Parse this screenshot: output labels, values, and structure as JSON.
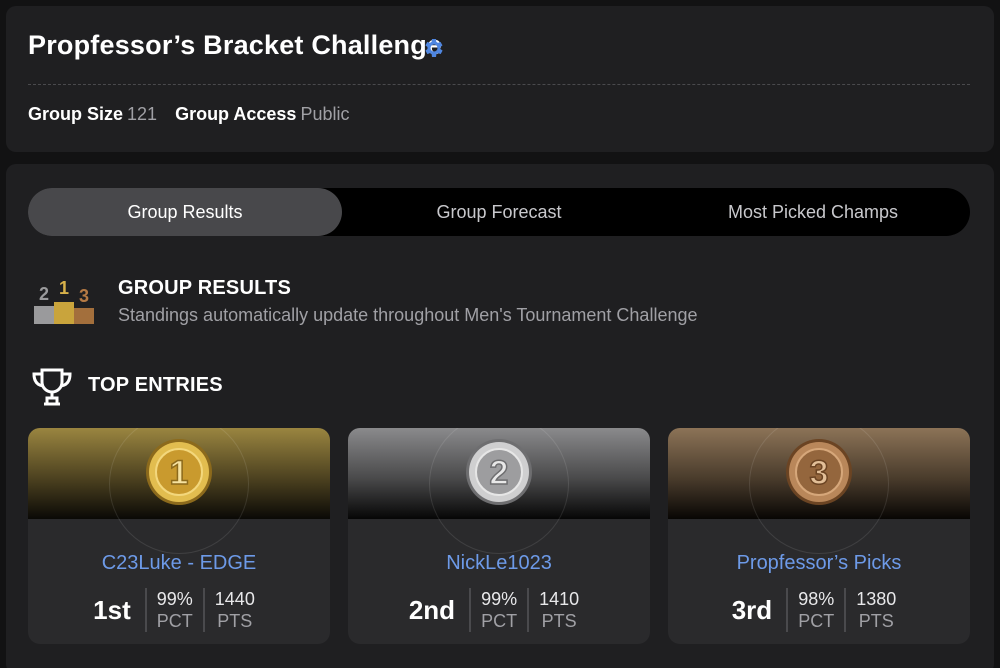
{
  "header": {
    "title": "Propfessor’s Bracket Challenge",
    "meta": [
      {
        "key": "Group Size",
        "value": "121"
      },
      {
        "key": "Group Access",
        "value": "Public"
      }
    ]
  },
  "tabs": [
    {
      "label": "Group Results",
      "active": true
    },
    {
      "label": "Group Forecast",
      "active": false
    },
    {
      "label": "Most Picked Champs",
      "active": false
    }
  ],
  "results_section": {
    "title": "GROUP RESULTS",
    "subtitle": "Standings automatically update throughout Men's Tournament Challenge",
    "podium_icon_digits": [
      "2",
      "1",
      "3"
    ]
  },
  "top_entries": {
    "title": "TOP ENTRIES",
    "cards": [
      {
        "medal": "1",
        "name": "C23Luke - EDGE",
        "rank": "1st",
        "pct": "99%",
        "pct_label": "PCT",
        "pts": "1440",
        "pts_label": "PTS"
      },
      {
        "medal": "2",
        "name": "NickLe1023",
        "rank": "2nd",
        "pct": "99%",
        "pct_label": "PCT",
        "pts": "1410",
        "pts_label": "PTS"
      },
      {
        "medal": "3",
        "name": "Propfessor’s Picks",
        "rank": "3rd",
        "pct": "98%",
        "pct_label": "PCT",
        "pts": "1380",
        "pts_label": "PTS"
      }
    ]
  },
  "colors": {
    "accent_blue": "#6d9ae8",
    "gear_blue": "#4f86e0",
    "gold": "#d8b14a",
    "silver": "#b8b8b8",
    "bronze": "#a97c52"
  }
}
